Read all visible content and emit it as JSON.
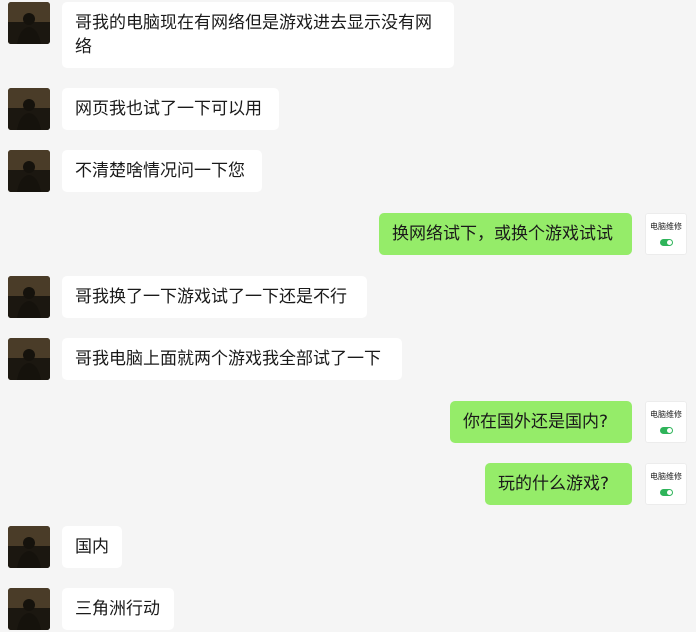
{
  "colors": {
    "background": "#f5f5f5",
    "incoming_bubble": "#ffffff",
    "outgoing_bubble": "#95ec69"
  },
  "contact_avatar": {
    "icon": "user-avatar-photo"
  },
  "service_avatar": {
    "brand": "电脑维修",
    "icon": "toggle-switch-icon"
  },
  "messages": [
    {
      "side": "left",
      "text": "哥我的电脑现在有网络但是游戏进去显示没有网络"
    },
    {
      "side": "left",
      "text": "网页我也试了一下可以用"
    },
    {
      "side": "left",
      "text": "不清楚啥情况问一下您"
    },
    {
      "side": "right",
      "text": "换网络试下，或换个游戏试试"
    },
    {
      "side": "left",
      "text": "哥我换了一下游戏试了一下还是不行"
    },
    {
      "side": "left",
      "text": "哥我电脑上面就两个游戏我全部试了一下"
    },
    {
      "side": "right",
      "text": "你在国外还是国内?"
    },
    {
      "side": "right",
      "text": "玩的什么游戏?"
    },
    {
      "side": "left",
      "text": "国内"
    },
    {
      "side": "left",
      "text": "三角洲行动"
    }
  ]
}
